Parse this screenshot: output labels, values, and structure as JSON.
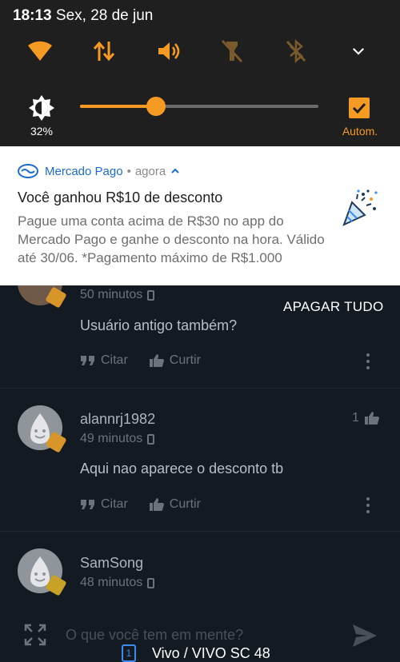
{
  "status_bar": {
    "time": "18:13",
    "date": "Sex, 28 de jun"
  },
  "quick_settings": {
    "tiles": [
      "wifi-icon",
      "mobile-data-icon",
      "sound-icon",
      "flashlight-off-icon",
      "bluetooth-off-icon"
    ],
    "brightness_percent": "32%",
    "brightness_level": 0.32,
    "auto_label": "Autom.",
    "accent": "#f59a23"
  },
  "notification": {
    "app": "Mercado Pago",
    "separator": "•",
    "time": "agora",
    "title": "Você ganhou R$10 de desconto",
    "body": "Pague uma conta acima de R$30 no app do Mercado Pago e ganhe o desconto na hora. Válido até 30/06. *Pagamento máximo de R$1.000",
    "brand_color": "#1a6cd1"
  },
  "clear_all": "APAGAR TUDO",
  "comments": [
    {
      "user": "",
      "time": "50 minutos",
      "text": "Usuário antigo também?",
      "quote": "Citar",
      "like": "Curtir",
      "likes": ""
    },
    {
      "user": "alannrj1982",
      "time": "49 minutos",
      "text": "Aqui nao aparece o desconto tb",
      "quote": "Citar",
      "like": "Curtir",
      "likes": "1"
    },
    {
      "user": "SamSong",
      "time": "48 minutos",
      "text": "",
      "quote": "",
      "like": "",
      "likes": ""
    }
  ],
  "composer": {
    "placeholder": "O que você tem em mente?"
  },
  "carrier": {
    "sim": "1",
    "name": "Vivo / VIVO SC 48"
  }
}
